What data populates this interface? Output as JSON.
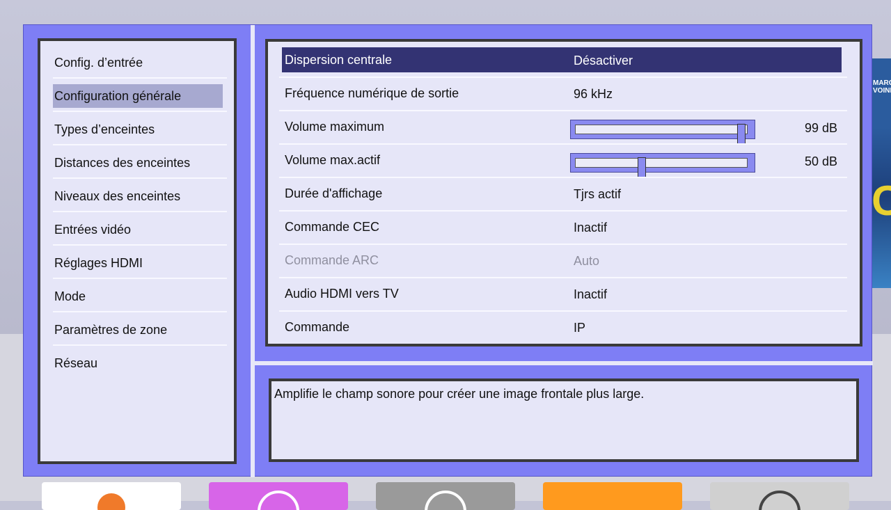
{
  "menu": {
    "items": [
      {
        "label": "Config. d’entrée"
      },
      {
        "label": "Configuration générale",
        "selected": true
      },
      {
        "label": "Types d’enceintes"
      },
      {
        "label": "Distances des enceintes"
      },
      {
        "label": "Niveaux des enceintes"
      },
      {
        "label": "Entrées vidéo"
      },
      {
        "label": "Réglages HDMI"
      },
      {
        "label": "Mode"
      },
      {
        "label": "Paramètres de zone"
      },
      {
        "label": "Réseau"
      }
    ]
  },
  "settings": {
    "rows": [
      {
        "label": "Dispersion centrale",
        "value": "Désactiver",
        "selected": true
      },
      {
        "label": "Fréquence numérique de sortie",
        "value": "96 kHz"
      },
      {
        "label": "Volume maximum",
        "value": "99 dB",
        "slider_fraction": 0.99
      },
      {
        "label": "Volume max.actif",
        "value": "50 dB",
        "slider_fraction": 0.38
      },
      {
        "label": "Durée d'affichage",
        "value": "Tjrs actif"
      },
      {
        "label": "Commande CEC",
        "value": "Inactif"
      },
      {
        "label": "Commande ARC",
        "value": "Auto",
        "disabled": true
      },
      {
        "label": "Audio HDMI vers TV",
        "value": "Inactif"
      },
      {
        "label": "Commande",
        "value": "IP"
      }
    ]
  },
  "help": {
    "text": "Amplifie le champ sonore pour créer une image frontale plus large."
  },
  "background": {
    "poster_text": "MARC\nVOINE"
  },
  "colors": {
    "frame": "#7e7ef5",
    "panel": "#e6e6f8",
    "selected_row": "#333373",
    "selected_menu": "#a7a9d0",
    "disabled_text": "#8f8f9f"
  }
}
